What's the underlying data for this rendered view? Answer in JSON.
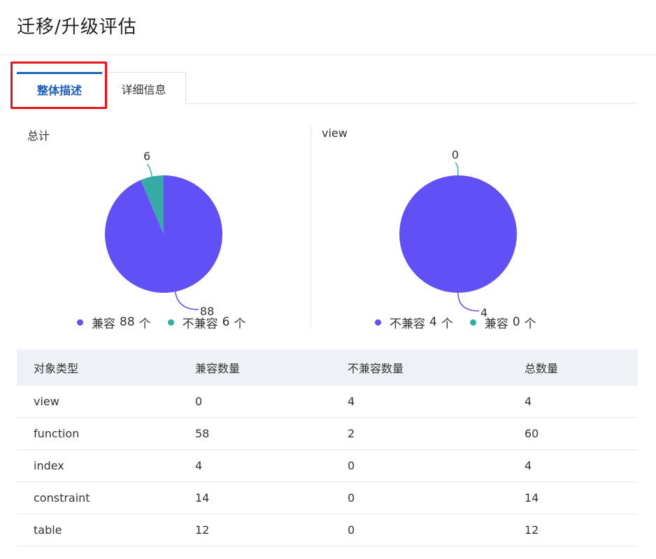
{
  "page": {
    "title": "迁移/升级评估"
  },
  "tabs": [
    {
      "label": "整体描述",
      "active": true
    },
    {
      "label": "详细信息",
      "active": false
    }
  ],
  "colors": {
    "compatible": "#6150f5",
    "incompatible": "#36aba6",
    "accent": "#1766c4",
    "highlight": "#e8141a"
  },
  "chart_data": [
    {
      "type": "pie",
      "title": "总计",
      "slices": [
        {
          "name": "兼容",
          "value": 88,
          "color": "#6150f5"
        },
        {
          "name": "不兼容",
          "value": 6,
          "color": "#36aba6"
        }
      ],
      "legend": [
        {
          "name": "兼容",
          "count": "88",
          "unit": "个",
          "color": "#6150f5"
        },
        {
          "name": "不兼容",
          "count": "6",
          "unit": "个",
          "color": "#36aba6"
        }
      ]
    },
    {
      "type": "pie",
      "title": "view",
      "slices": [
        {
          "name": "不兼容",
          "value": 4,
          "color": "#6150f5"
        },
        {
          "name": "兼容",
          "value": 0,
          "color": "#36aba6"
        }
      ],
      "legend": [
        {
          "name": "不兼容",
          "count": "4",
          "unit": "个",
          "color": "#6150f5"
        },
        {
          "name": "兼容",
          "count": "0",
          "unit": "个",
          "color": "#36aba6"
        }
      ]
    }
  ],
  "table": {
    "headers": [
      "对象类型",
      "兼容数量",
      "不兼容数量",
      "总数量"
    ],
    "rows": [
      [
        "view",
        "0",
        "4",
        "4"
      ],
      [
        "function",
        "58",
        "2",
        "60"
      ],
      [
        "index",
        "4",
        "0",
        "4"
      ],
      [
        "constraint",
        "14",
        "0",
        "14"
      ],
      [
        "table",
        "12",
        "0",
        "12"
      ]
    ]
  }
}
